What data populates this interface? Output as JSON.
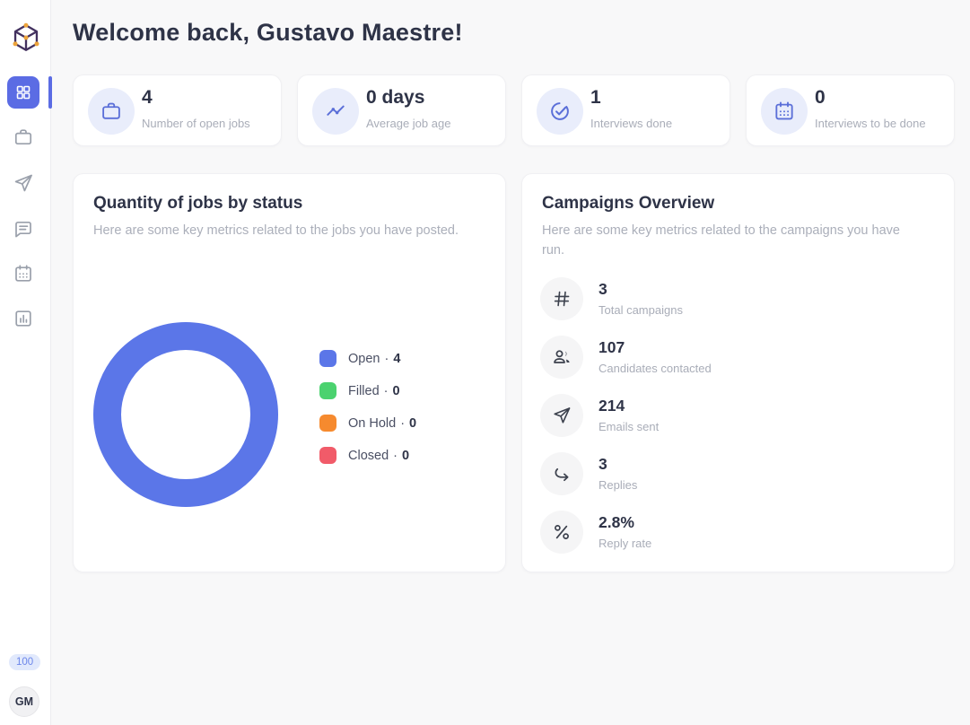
{
  "theme": {
    "accent": "#5b6ce4",
    "stat_icon_color": "#5b6fd8",
    "stat_icon_bg": "#e9edfb",
    "page_bg": "#f8f8f9",
    "text_dark": "#2e3347",
    "text_muted": "#a9adb8"
  },
  "sidebar": {
    "logo": "cube-logo",
    "items": [
      {
        "icon": "dashboard-grid-icon",
        "active": true
      },
      {
        "icon": "briefcase-icon",
        "active": false
      },
      {
        "icon": "send-icon",
        "active": false
      },
      {
        "icon": "chat-icon",
        "active": false
      },
      {
        "icon": "calendar-icon",
        "active": false
      },
      {
        "icon": "bar-chart-icon",
        "active": false
      }
    ],
    "credits_badge": "100",
    "avatar_initials": "GM"
  },
  "header": {
    "title": "Welcome back, Gustavo Maestre!"
  },
  "stat_cards": [
    {
      "icon": "briefcase-icon",
      "value": "4",
      "label": "Number of open jobs"
    },
    {
      "icon": "trend-line-icon",
      "value": "0 days",
      "label": "Average job age"
    },
    {
      "icon": "check-circle-icon",
      "value": "1",
      "label": "Interviews done"
    },
    {
      "icon": "calendar-icon",
      "value": "0",
      "label": "Interviews to be done"
    }
  ],
  "jobs_panel": {
    "title": "Quantity of jobs by status",
    "subtitle": "Here are some key metrics related to the jobs you have posted."
  },
  "campaigns_panel": {
    "title": "Campaigns Overview",
    "subtitle": "Here are some key metrics related to the campaigns you have run.",
    "metrics": [
      {
        "icon": "hash-icon",
        "value": "3",
        "label": "Total campaigns"
      },
      {
        "icon": "people-icon",
        "value": "107",
        "label": "Candidates contacted"
      },
      {
        "icon": "send-icon",
        "value": "214",
        "label": "Emails sent"
      },
      {
        "icon": "reply-arrow-icon",
        "value": "3",
        "label": "Replies"
      },
      {
        "icon": "percent-icon",
        "value": "2.8%",
        "label": "Reply rate"
      }
    ]
  },
  "chart_data": {
    "type": "pie",
    "variant": "donut",
    "title": "Quantity of jobs by status",
    "categories": [
      "Open",
      "Filled",
      "On Hold",
      "Closed"
    ],
    "values": [
      4,
      0,
      0,
      0
    ],
    "colors": [
      "#5b76e8",
      "#4bd26f",
      "#f68a2e",
      "#f15b69"
    ],
    "legend_position": "right",
    "donut_hole_ratio": 0.69,
    "legend": [
      {
        "label": "Open",
        "separator": "·",
        "value": "4",
        "color": "#5b76e8"
      },
      {
        "label": "Filled",
        "separator": "·",
        "value": "0",
        "color": "#4bd26f"
      },
      {
        "label": "On Hold",
        "separator": "·",
        "value": "0",
        "color": "#f68a2e"
      },
      {
        "label": "Closed",
        "separator": "·",
        "value": "0",
        "color": "#f15b69"
      }
    ]
  }
}
